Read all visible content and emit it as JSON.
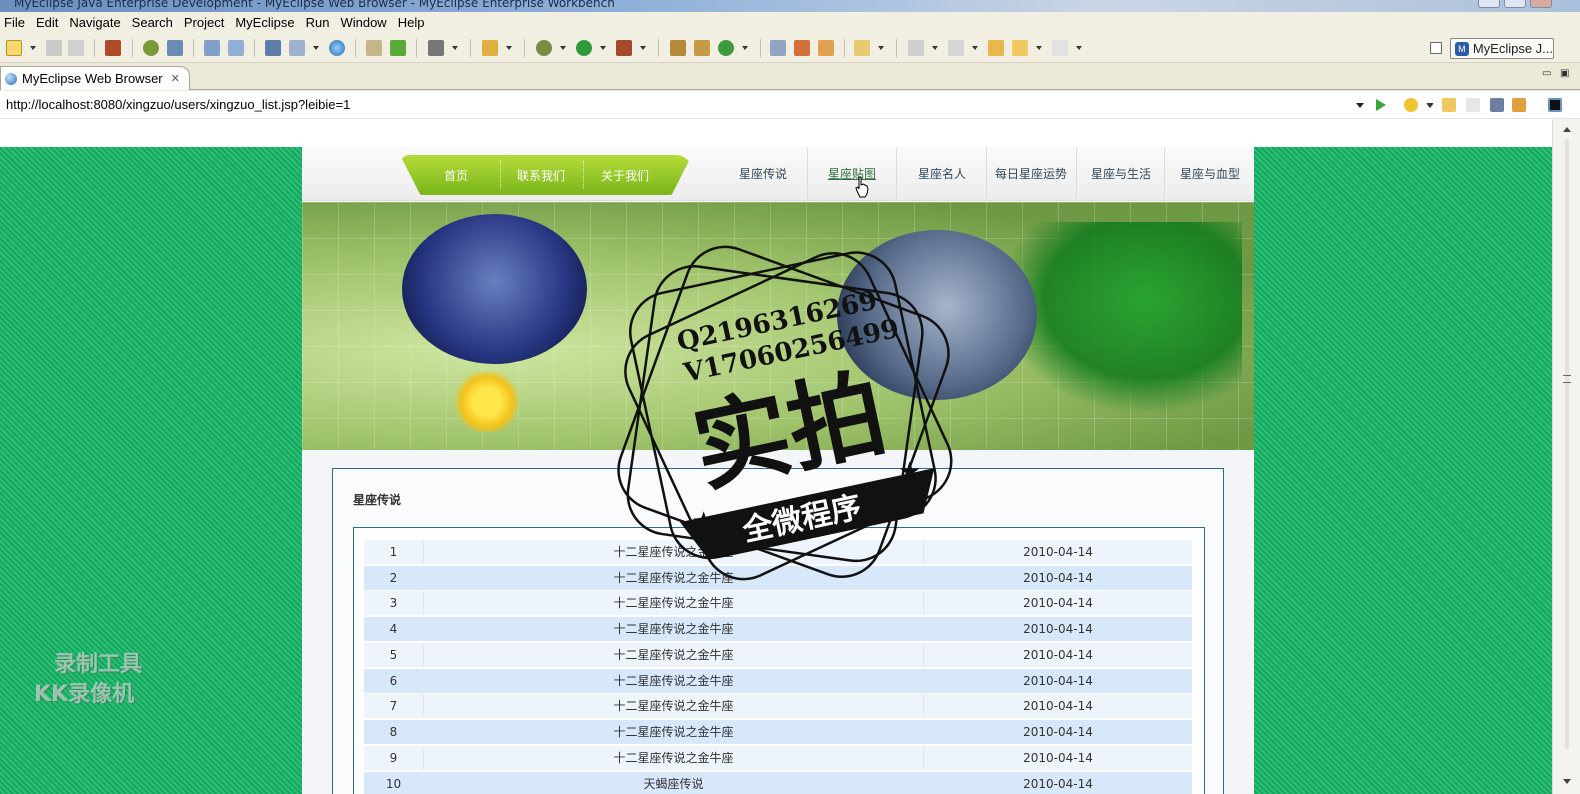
{
  "window": {
    "title": "MyEclipse Java Enterprise Development - MyEclipse Web Browser - MyEclipse Enterprise Workbench"
  },
  "menu": [
    "File",
    "Edit",
    "Navigate",
    "Search",
    "Project",
    "MyEclipse",
    "Run",
    "Window",
    "Help"
  ],
  "perspective": {
    "label": "MyEclipse J..."
  },
  "tab": {
    "label": "MyEclipse Web Browser",
    "close": "✕"
  },
  "address": {
    "url": "http://localhost:8080/xingzuo/users/xingzuo_list.jsp?leibie=1"
  },
  "site": {
    "green_nav": [
      "首页",
      "联系我们",
      "关于我们"
    ],
    "nav": [
      "星座传说",
      "星座贴图",
      "星座名人",
      "每日星座运势",
      "星座与生活",
      "星座与血型"
    ],
    "active_nav": "星座贴图",
    "section_title": "星座传说",
    "rows": [
      {
        "n": "1",
        "title": "十二星座传说之金牛座",
        "date": "2010-04-14"
      },
      {
        "n": "2",
        "title": "十二星座传说之金牛座",
        "date": "2010-04-14"
      },
      {
        "n": "3",
        "title": "十二星座传说之金牛座",
        "date": "2010-04-14"
      },
      {
        "n": "4",
        "title": "十二星座传说之金牛座",
        "date": "2010-04-14"
      },
      {
        "n": "5",
        "title": "十二星座传说之金牛座",
        "date": "2010-04-14"
      },
      {
        "n": "6",
        "title": "十二星座传说之金牛座",
        "date": "2010-04-14"
      },
      {
        "n": "7",
        "title": "十二星座传说之金牛座",
        "date": "2010-04-14"
      },
      {
        "n": "8",
        "title": "十二星座传说之金牛座",
        "date": "2010-04-14"
      },
      {
        "n": "9",
        "title": "十二星座传说之金牛座",
        "date": "2010-04-14"
      },
      {
        "n": "10",
        "title": "天蝎座传说",
        "date": "2010-04-14"
      }
    ]
  },
  "watermark": {
    "qq": "Q2196316269",
    "wx": "V17060256499",
    "big": "实拍",
    "ribbon": "全微程序",
    "recorder_line1": "录制工具",
    "recorder_line2": "KK录像机"
  },
  "colors": {
    "page_bg": "#13a65c",
    "nav_green": "#79b51a",
    "row_blue": "#d7e8fa",
    "border": "#2b6c87"
  }
}
